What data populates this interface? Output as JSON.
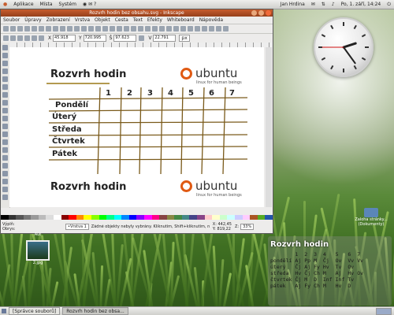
{
  "top_panel": {
    "menus": [
      "Aplikace",
      "Místa",
      "Systém"
    ],
    "user": "Jan Hrdina",
    "datetime": "Po, 1. září, 14:24"
  },
  "window": {
    "title": "Rozvrh hodin bez obsahu.svg - Inkscape",
    "menus": [
      "Soubor",
      "Úpravy",
      "Zobrazení",
      "Vrstva",
      "Objekt",
      "Cesta",
      "Text",
      "Efekty",
      "Whiteboard",
      "Nápověda"
    ],
    "controls": {
      "x_label": "X",
      "x_value": "45.918",
      "y_label": "Y",
      "y_value": "720.995",
      "w_label": "Š",
      "w_value": "97.623",
      "h_label": "V",
      "h_value": "22.791",
      "unit": "px"
    },
    "status": {
      "fill_label": "Výplň:",
      "stroke_label": "Obrys:",
      "layer": "•Vrstva 1",
      "message": "Žádné objekty nebyly vybrány. Kliknutím, Shift+kliknutím, ne...",
      "coord_x": "X: 442,45",
      "coord_y": "Y: 819,22",
      "zoom_label": "Z:",
      "zoom": "33%"
    }
  },
  "document": {
    "title": "Rozvrh hodin",
    "brand": "ubuntu",
    "tagline": "linux for human beings",
    "columns": [
      "1",
      "2",
      "3",
      "4",
      "5",
      "6",
      "7"
    ],
    "days": [
      "Pondělí",
      "Úterý",
      "Středa",
      "Čtvrtek",
      "Pátek"
    ]
  },
  "desktop": {
    "folder_label": "Zaloha stránky... (Dokumenty)",
    "image_label": "Aut",
    "file_label": "2.jpg"
  },
  "widget": {
    "title": "Rozvrh hodin",
    "header": [
      "1",
      "2",
      "3",
      "4",
      "5",
      "6",
      "7"
    ],
    "rows": [
      {
        "day": "pondělí",
        "cells": [
          "Aj",
          "Pp",
          "M",
          "Čj",
          "Ov",
          "Vv",
          "Vv"
        ]
      },
      {
        "day": "úterý",
        "cells": [
          "Čj",
          "Aj",
          "Fy",
          "Hv",
          "Tv",
          "Ov",
          ""
        ]
      },
      {
        "day": "středa",
        "cells": [
          "Hv",
          "Čj",
          "Ch",
          "M",
          "Aj",
          "Hv",
          "Ov"
        ]
      },
      {
        "day": "čtvrtek",
        "cells": [
          "Čj",
          "M",
          "D",
          "Inf",
          "Inf",
          "Tv",
          ""
        ]
      },
      {
        "day": "pátek",
        "cells": [
          "Aj",
          "Fy",
          "Ch",
          "M",
          "Hv",
          "D",
          ""
        ]
      }
    ]
  },
  "taskbar": {
    "items": [
      "[Správce souborů]",
      "Rozvrh hodin bez obsa..."
    ]
  },
  "colors": {
    "title_orange": "#b34a1c",
    "ubuntu_orange": "#e05a13",
    "grid_brown": "#7a5a1a"
  }
}
